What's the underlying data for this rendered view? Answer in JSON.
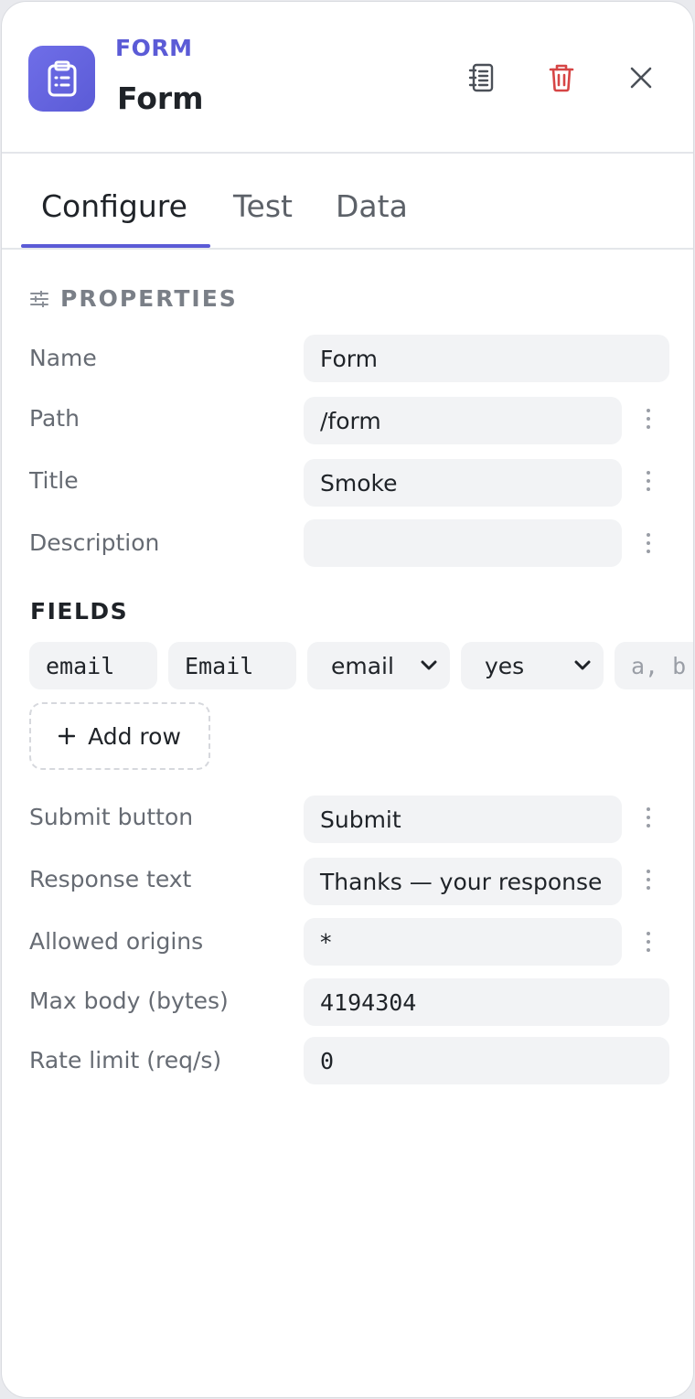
{
  "header": {
    "kind": "FORM",
    "name": "Form",
    "icons": {
      "app": "clipboard-icon",
      "notes": "notebook-icon",
      "delete": "trash-icon",
      "close": "close-icon"
    }
  },
  "tabs": [
    {
      "label": "Configure",
      "active": true
    },
    {
      "label": "Test",
      "active": false
    },
    {
      "label": "Data",
      "active": false
    }
  ],
  "properties": {
    "section_title": "PROPERTIES",
    "name": {
      "label": "Name",
      "value": "Form"
    },
    "path": {
      "label": "Path",
      "value": "/form"
    },
    "title": {
      "label": "Title",
      "value": "Smoke"
    },
    "description": {
      "label": "Description",
      "value": ""
    }
  },
  "fields": {
    "title": "FIELDS",
    "row": {
      "name": "email",
      "label": "Email",
      "type": "email",
      "required": "yes",
      "options_placeholder": "a, b"
    },
    "add_row_label": "Add row"
  },
  "settings": {
    "submit_button": {
      "label": "Submit button",
      "value": "Submit"
    },
    "response_text": {
      "label": "Response text",
      "value": "Thanks — your response"
    },
    "allowed_origins": {
      "label": "Allowed origins",
      "value": "*"
    },
    "max_body": {
      "label": "Max body (bytes)",
      "value": "4194304"
    },
    "rate_limit": {
      "label": "Rate limit (req/s)",
      "value": "0"
    }
  },
  "colors": {
    "accent": "#5b5bd6",
    "danger": "#d64545",
    "field_bg": "#f2f3f5"
  }
}
